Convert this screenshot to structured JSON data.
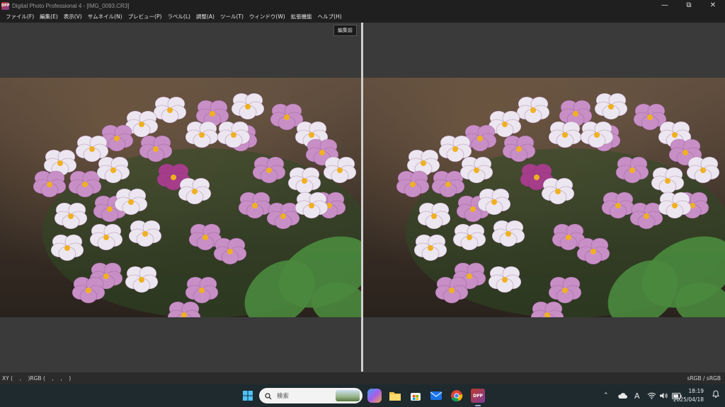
{
  "window": {
    "title": "Digital Photo Professional 4 - [IMG_0093.CR3]",
    "app_icon_text": "DPP",
    "minimize": "—",
    "restore": "⧉",
    "close": "✕"
  },
  "menu": [
    "ファイル(F)",
    "編集(E)",
    "表示(V)",
    "サムネイル(N)",
    "プレビュー(P)",
    "ラベル(L)",
    "調整(A)",
    "ツール(T)",
    "ウィンドウ(W)",
    "拡張機能",
    "ヘルプ(H)"
  ],
  "preview": {
    "before_label": "編集前"
  },
  "status": {
    "left": "XY (    ,    )RGB (    ,    ,    )",
    "right": "sRGB / sRGB"
  },
  "taskbar": {
    "search_placeholder": "検索",
    "time": "18:19",
    "date": "2025/04/18",
    "ime": "A"
  },
  "icons": {
    "start": "windows-start-icon",
    "search": "search-icon",
    "copilot": "copilot-icon",
    "explorer": "file-explorer-icon",
    "store": "store-icon",
    "mail": "mail-icon",
    "chrome": "chrome-icon",
    "dpp": "dpp-app-icon",
    "chevron": "chevron-up-icon",
    "cloud": "cloud-icon",
    "wifi": "wifi-icon",
    "speaker": "speaker-icon",
    "battery": "battery-icon",
    "bell": "notification-bell-icon"
  },
  "colors": {
    "menubar": "#1f1f1f",
    "pane": "#3a3a3a",
    "taskbar": "#1e2a2e",
    "petal_pink": "#c88fc6",
    "petal_white": "#ece6f0",
    "petal_magenta": "#a53d8a",
    "flower_center": "#f0b020",
    "leaf": "#4a8a3e"
  }
}
